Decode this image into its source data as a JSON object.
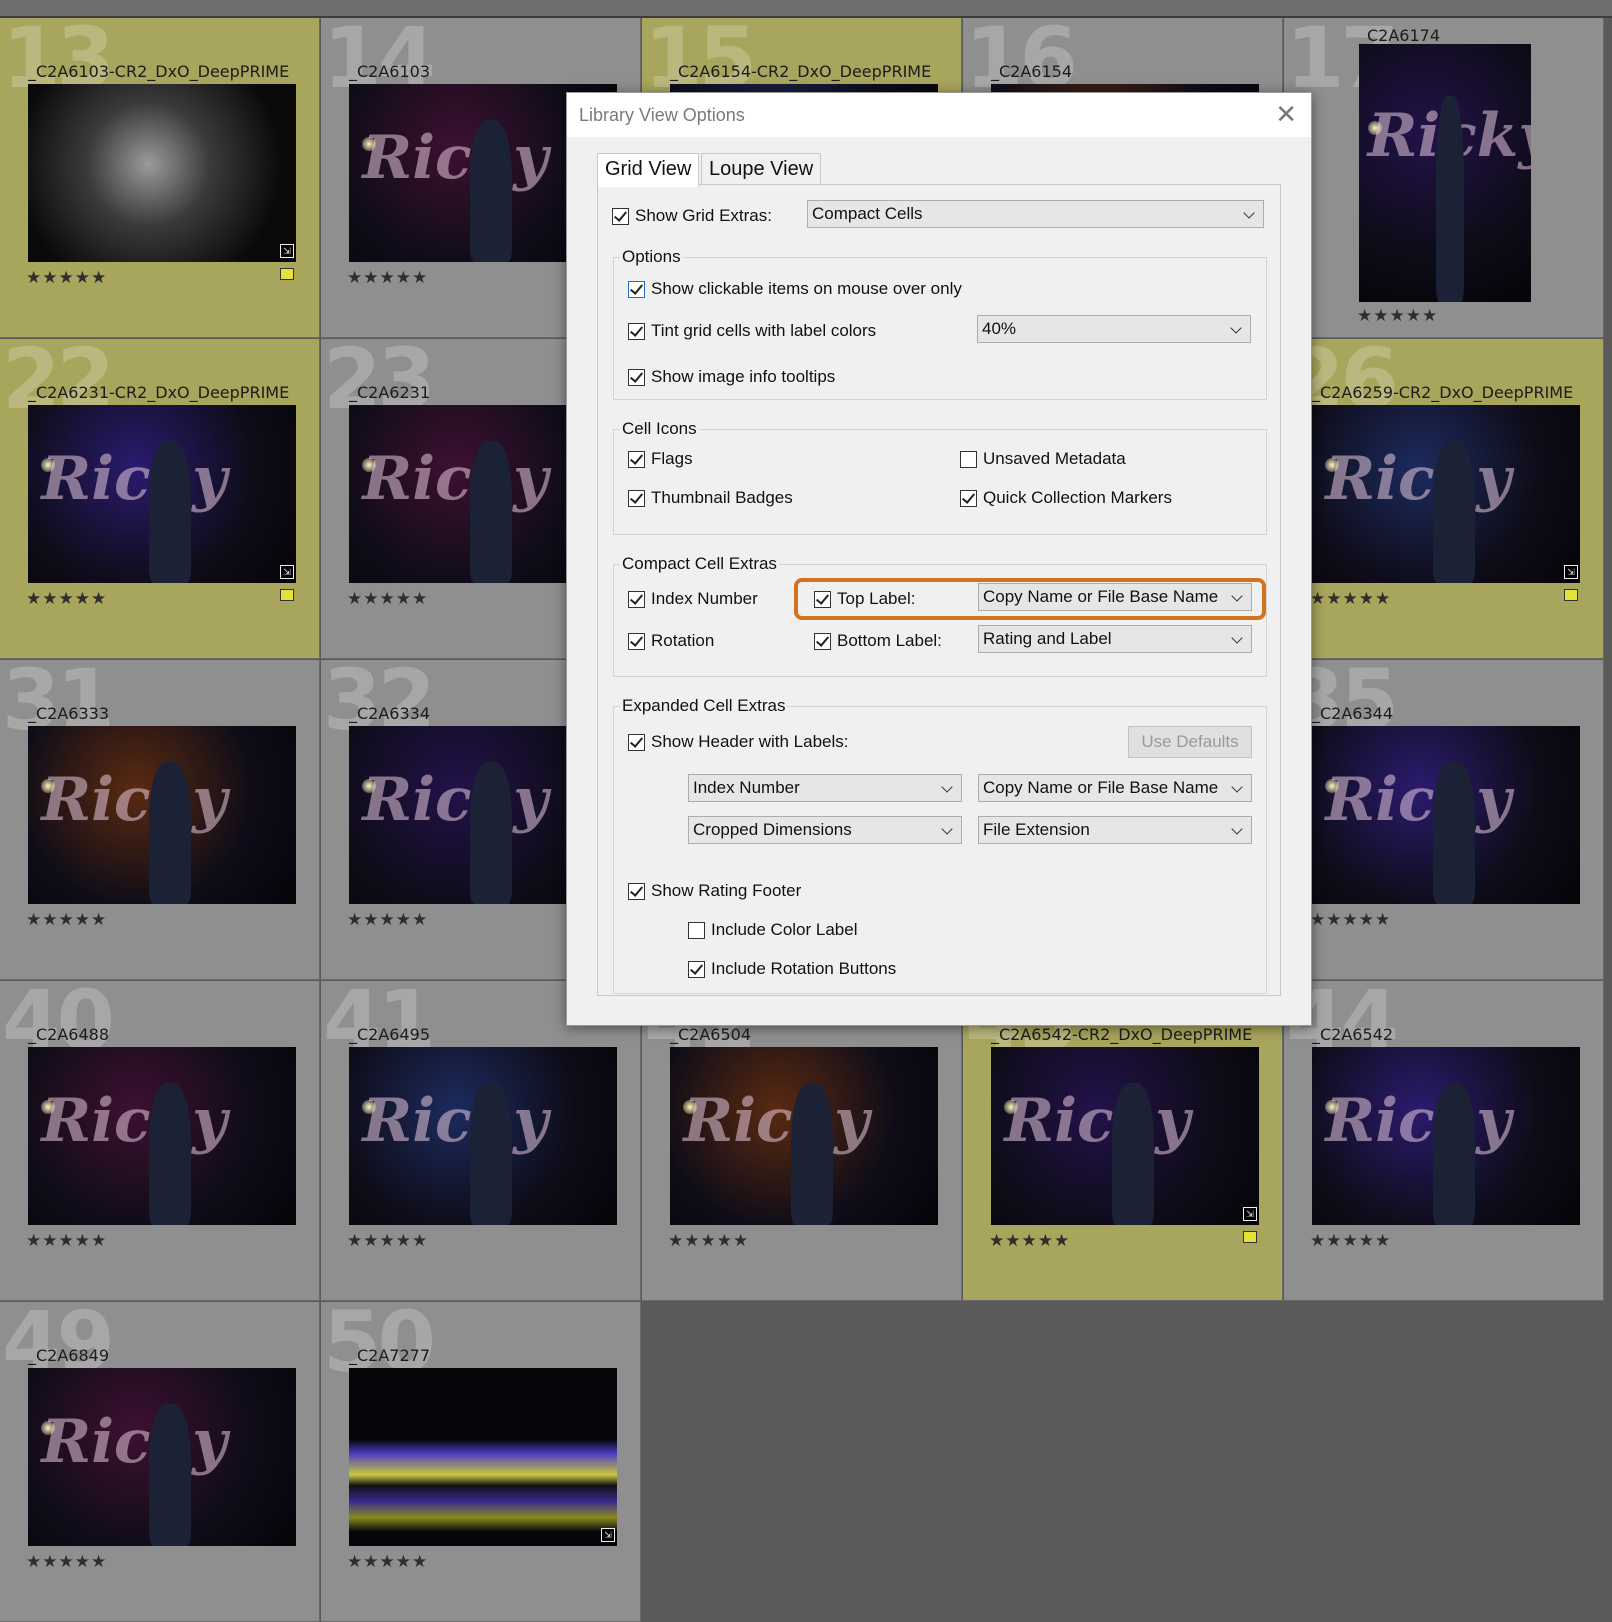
{
  "grid": {
    "cells": [
      {
        "index": "13",
        "name": "_C2A6103-CR2_DxO_DeepPRIME",
        "rating": "★★★★★",
        "tinted": true,
        "badge": true,
        "swatch": true
      },
      {
        "index": "14",
        "name": "_C2A6103",
        "rating": "★★★★★",
        "tinted": false,
        "badge": false,
        "swatch": false
      },
      {
        "index": "15",
        "name": "_C2A6154-CR2_DxO_DeepPRIME",
        "rating": "",
        "tinted": true,
        "badge": false,
        "swatch": false
      },
      {
        "index": "16",
        "name": "_C2A6154",
        "rating": "",
        "tinted": false,
        "badge": false,
        "swatch": false
      },
      {
        "index": "17",
        "name": "_C2A6174",
        "rating": "★★★★★",
        "tinted": false,
        "badge": false,
        "swatch": false,
        "portrait": true
      },
      {
        "index": "22",
        "name": "_C2A6231-CR2_DxO_DeepPRIME",
        "rating": "★★★★★",
        "tinted": true,
        "badge": true,
        "swatch": true
      },
      {
        "index": "23",
        "name": "_C2A6231",
        "rating": "★★★★★",
        "tinted": false,
        "badge": false,
        "swatch": false
      },
      {
        "index": "26",
        "name": "_C2A6259-CR2_DxO_DeepPRIME",
        "rating": "★★★★★",
        "tinted": true,
        "badge": true,
        "swatch": true
      },
      {
        "index": "31",
        "name": "_C2A6333",
        "rating": "★★★★★",
        "tinted": false,
        "badge": false,
        "swatch": false
      },
      {
        "index": "32",
        "name": "_C2A6334",
        "rating": "★★★★★",
        "tinted": false,
        "badge": false,
        "swatch": false
      },
      {
        "index": "35",
        "name": "_C2A6344",
        "rating": "★★★★★",
        "tinted": false,
        "badge": false,
        "swatch": false
      },
      {
        "index": "40",
        "name": "_C2A6488",
        "rating": "★★★★★",
        "tinted": false,
        "badge": false,
        "swatch": false
      },
      {
        "index": "41",
        "name": "_C2A6495",
        "rating": "★★★★★",
        "tinted": false,
        "badge": false,
        "swatch": false
      },
      {
        "index": "42",
        "name": "_C2A6504",
        "rating": "★★★★★",
        "tinted": false,
        "badge": false,
        "swatch": false
      },
      {
        "index": "43",
        "name": "_C2A6542-CR2_DxO_DeepPRIME",
        "rating": "★★★★★",
        "tinted": true,
        "badge": true,
        "swatch": true
      },
      {
        "index": "44",
        "name": "_C2A6542",
        "rating": "★★★★★",
        "tinted": false,
        "badge": false,
        "swatch": false
      },
      {
        "index": "49",
        "name": "_C2A6849",
        "rating": "★★★★★",
        "tinted": false,
        "badge": false,
        "swatch": false
      },
      {
        "index": "50",
        "name": "_C2A7277",
        "rating": "★★★★★",
        "tinted": false,
        "badge": true,
        "swatch": false
      }
    ]
  },
  "dialog": {
    "title": "Library View Options",
    "close_icon": "close-icon",
    "tabs": [
      "Grid View",
      "Loupe View"
    ],
    "active_tab": "Grid View",
    "show_grid_extras": {
      "label": "Show Grid Extras:",
      "checked": true,
      "value": "Compact Cells"
    },
    "options": {
      "title": "Options",
      "show_clickable": {
        "label": "Show clickable items on mouse over only",
        "checked": true
      },
      "tint_cells": {
        "label": "Tint grid cells with label colors",
        "checked": true,
        "value": "40%"
      },
      "image_tooltips": {
        "label": "Show image info tooltips",
        "checked": true
      }
    },
    "cell_icons": {
      "title": "Cell Icons",
      "flags": {
        "label": "Flags",
        "checked": true
      },
      "unsaved_metadata": {
        "label": "Unsaved Metadata",
        "checked": false
      },
      "thumbnail_badges": {
        "label": "Thumbnail Badges",
        "checked": true
      },
      "quick_collection": {
        "label": "Quick Collection Markers",
        "checked": true
      }
    },
    "compact_cell_extras": {
      "title": "Compact Cell Extras",
      "index_number": {
        "label": "Index Number",
        "checked": true
      },
      "rotation": {
        "label": "Rotation",
        "checked": true
      },
      "top_label": {
        "label": "Top Label:",
        "checked": true,
        "value": "Copy Name or File Base Name"
      },
      "bottom_label": {
        "label": "Bottom Label:",
        "checked": true,
        "value": "Rating and Label"
      }
    },
    "expanded_cell_extras": {
      "title": "Expanded Cell Extras",
      "show_header": {
        "label": "Show Header with Labels:",
        "checked": true
      },
      "use_defaults": "Use Defaults",
      "header_fields": [
        "Index Number",
        "Copy Name or File Base Name",
        "Cropped Dimensions",
        "File Extension"
      ],
      "rating_footer": {
        "label": "Show Rating Footer",
        "checked": true
      },
      "include_color_label": {
        "label": "Include Color Label",
        "checked": false
      },
      "include_rotation": {
        "label": "Include Rotation Buttons",
        "checked": true
      }
    },
    "highlight_color": "#d4731e"
  }
}
